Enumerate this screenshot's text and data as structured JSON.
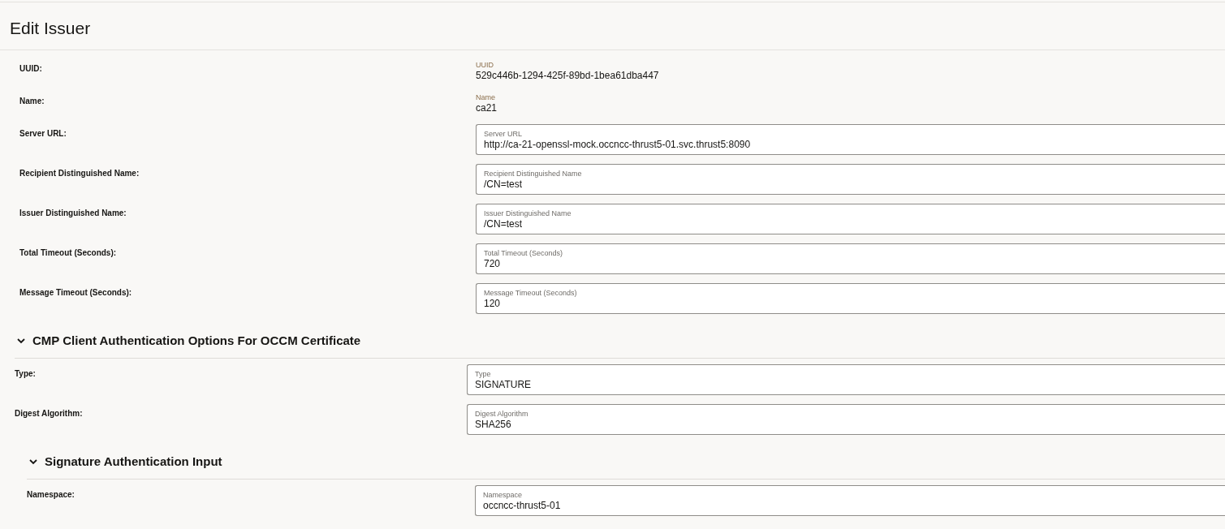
{
  "title": "Edit Issuer",
  "rows": [
    {
      "kind": "readonly",
      "label": "UUID:",
      "field_label": "UUID",
      "value": "529c446b-1294-425f-89bd-1bea61dba447"
    },
    {
      "kind": "readonly",
      "label": "Name:",
      "field_label": "Name",
      "value": "ca21"
    },
    {
      "kind": "input",
      "label": "Server URL:",
      "field_label": "Server URL",
      "value": "http://ca-21-openssl-mock.occncc-thrust5-01.svc.thrust5:8090"
    },
    {
      "kind": "input",
      "label": "Recipient Distinguished Name:",
      "field_label": "Recipient Distinguished Name",
      "value": "/CN=test"
    },
    {
      "kind": "input",
      "label": "Issuer Distinguished Name:",
      "field_label": "Issuer Distinguished Name",
      "value": "/CN=test"
    },
    {
      "kind": "input",
      "label": "Total Timeout (Seconds):",
      "field_label": "Total Timeout (Seconds)",
      "value": "720"
    },
    {
      "kind": "input",
      "label": "Message Timeout (Seconds):",
      "field_label": "Message Timeout (Seconds)",
      "value": "120"
    }
  ],
  "sections": [
    {
      "title": "CMP Client Authentication Options For OCCM Certificate",
      "expanded": true,
      "rows": [
        {
          "kind": "input",
          "label": "Type:",
          "field_label": "Type",
          "value": "SIGNATURE"
        },
        {
          "kind": "input",
          "label": "Digest Algorithm:",
          "field_label": "Digest Algorithm",
          "value": "SHA256"
        }
      ],
      "sections": [
        {
          "title": "Signature Authentication Input",
          "expanded": true,
          "rows": [
            {
              "kind": "input",
              "label": "Namespace:",
              "field_label": "Namespace",
              "value": "occncc-thrust5-01"
            }
          ]
        }
      ]
    }
  ]
}
